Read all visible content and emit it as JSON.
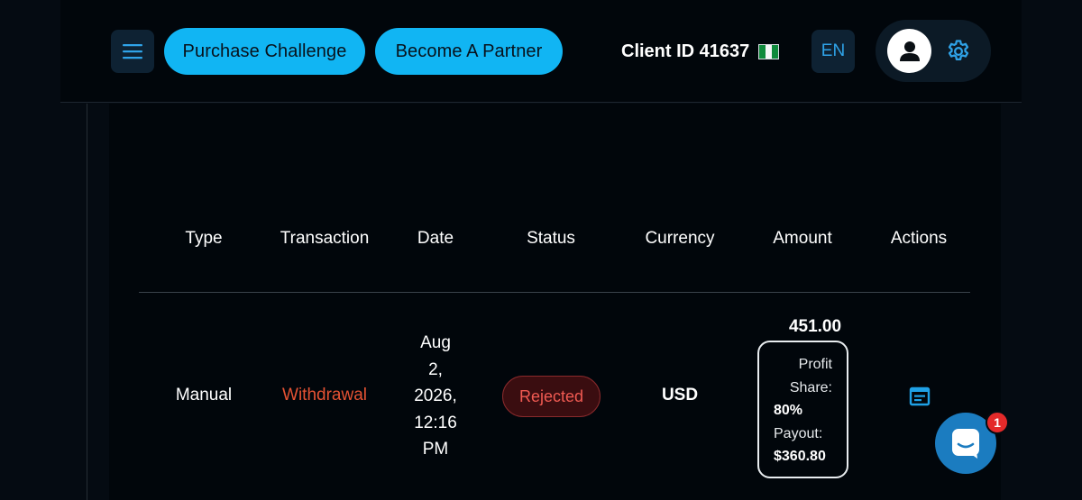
{
  "header": {
    "menu_icon": "hamburger-menu-icon",
    "purchase_label": "Purchase Challenge",
    "partner_label": "Become A Partner",
    "client_id": "Client ID 41637",
    "flag_icon": "nigeria-flag-icon",
    "language": "EN",
    "avatar_icon": "user-avatar-icon",
    "settings_icon": "gear-icon"
  },
  "colors": {
    "accent": "#11b5f3",
    "rejected": "#f05a52",
    "withdrawal": "#e55233",
    "background": "#050b12"
  },
  "table": {
    "columns": [
      "Type",
      "Transaction",
      "Date",
      "Status",
      "Currency",
      "Amount",
      "Actions"
    ],
    "rows": [
      {
        "type": "Manual",
        "transaction": "Withdrawal",
        "date_lines": [
          "Aug",
          "2,",
          "2026,",
          "12:16",
          "PM"
        ],
        "status": "Rejected",
        "currency": "USD",
        "amount": "451.00",
        "details": {
          "profit": "Profit",
          "share": "Share:",
          "share_value": "80%",
          "payout": "Payout:",
          "payout_value": "$360.80"
        },
        "action_icon": "receipt-details-icon"
      }
    ]
  },
  "chat": {
    "icon": "chat-bubble-icon",
    "unread_count": "1"
  }
}
